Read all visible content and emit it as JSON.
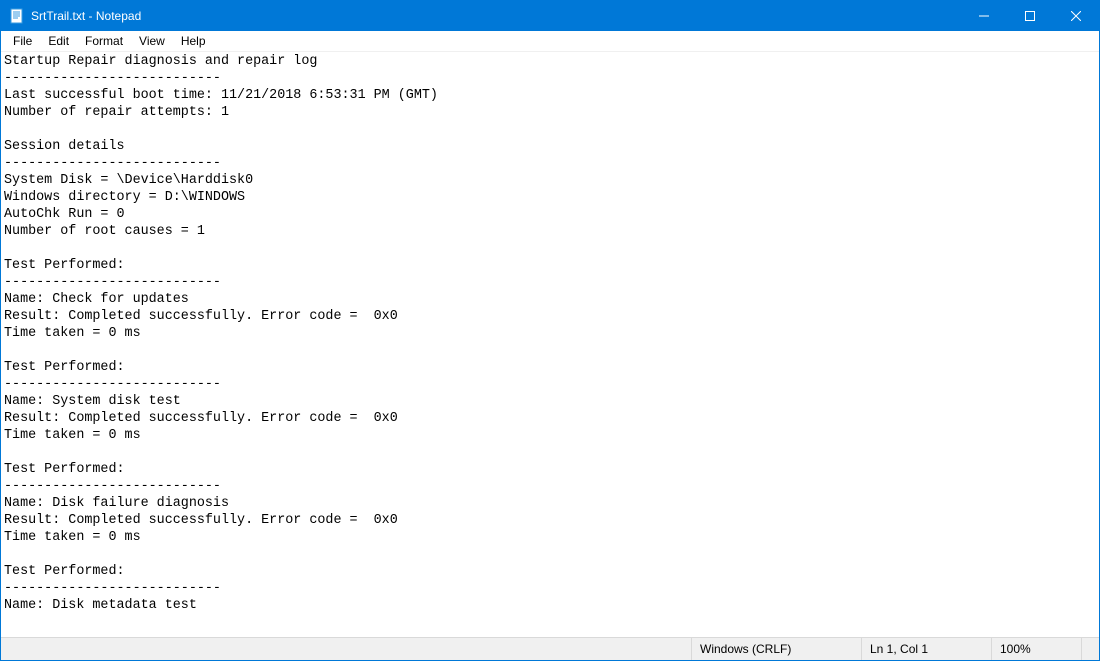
{
  "window": {
    "title": "SrtTrail.txt - Notepad"
  },
  "menu": {
    "file": "File",
    "edit": "Edit",
    "format": "Format",
    "view": "View",
    "help": "Help"
  },
  "content": "Startup Repair diagnosis and repair log\n---------------------------\nLast successful boot time: 11/21/2018 6:53:31 PM (GMT)\nNumber of repair attempts: 1\n\nSession details\n---------------------------\nSystem Disk = \\Device\\Harddisk0\nWindows directory = D:\\WINDOWS\nAutoChk Run = 0\nNumber of root causes = 1\n\nTest Performed:\n---------------------------\nName: Check for updates\nResult: Completed successfully. Error code =  0x0\nTime taken = 0 ms\n\nTest Performed:\n---------------------------\nName: System disk test\nResult: Completed successfully. Error code =  0x0\nTime taken = 0 ms\n\nTest Performed:\n---------------------------\nName: Disk failure diagnosis\nResult: Completed successfully. Error code =  0x0\nTime taken = 0 ms\n\nTest Performed:\n---------------------------\nName: Disk metadata test\n",
  "statusbar": {
    "encoding": "Windows (CRLF)",
    "position": "Ln 1, Col 1",
    "zoom": "100%"
  }
}
